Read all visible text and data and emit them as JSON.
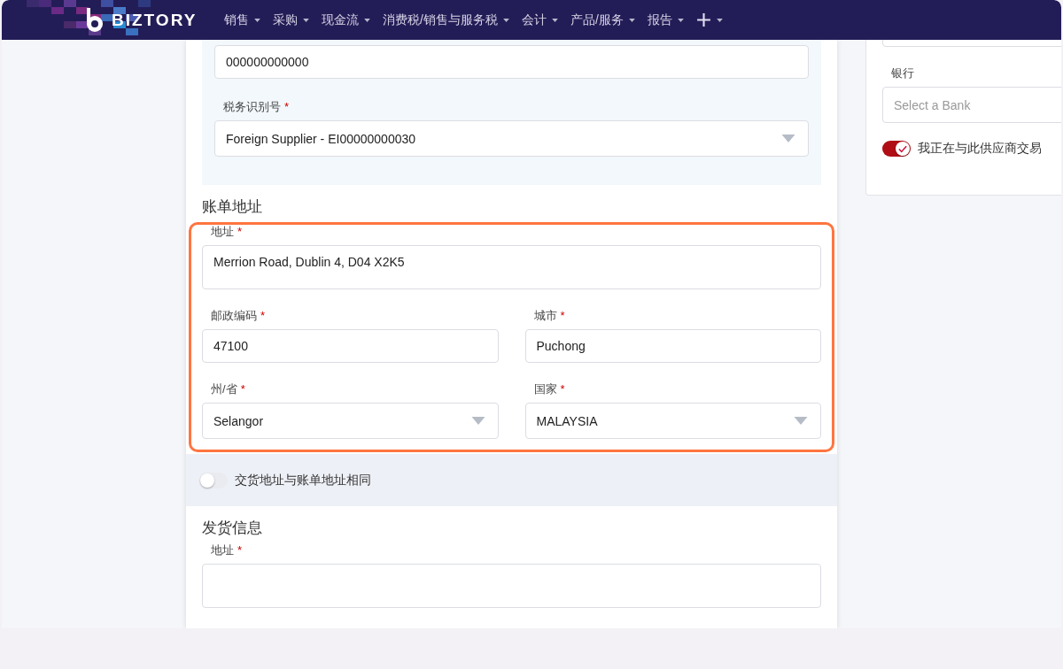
{
  "nav": {
    "brand": "BIZTORY",
    "menu": [
      {
        "kind": "menu",
        "label": "销售"
      },
      {
        "kind": "menu",
        "label": "采购"
      },
      {
        "kind": "menu",
        "label": "现金流"
      },
      {
        "kind": "menu",
        "label": "消费税/销售与服务税"
      },
      {
        "kind": "menu",
        "label": "会计"
      },
      {
        "kind": "menu",
        "label": "产品/服务"
      },
      {
        "kind": "menu",
        "label": "报告"
      },
      {
        "kind": "add"
      }
    ]
  },
  "tax_section": {
    "fields": [
      {
        "kind": "text",
        "value": "000000000000"
      },
      {
        "kind": "select",
        "label": "税务识别号",
        "asterisk": "*",
        "value": "Foreign Supplier - EI00000000030"
      }
    ]
  },
  "billing_address": {
    "title": "账单地址",
    "address": {
      "kind": "textarea",
      "label": "地址",
      "asterisk": "*",
      "value": "Merrion Road, Dublin 4, D04 X2K5"
    },
    "grid": [
      {
        "kind": "text",
        "label": "邮政编码",
        "asterisk": "*",
        "value": "47100"
      },
      {
        "kind": "text",
        "label": "城市",
        "asterisk": "*",
        "value": "Puchong"
      },
      {
        "kind": "select",
        "label": "州/省",
        "asterisk": "*",
        "value": "Selangor"
      },
      {
        "kind": "select",
        "label": "国家",
        "asterisk": "*",
        "value": "MALAYSIA"
      }
    ]
  },
  "same_address_toggle": {
    "label": "交货地址与账单地址相同",
    "on": false
  },
  "shipping_info": {
    "title": "发货信息",
    "address": {
      "kind": "textarea",
      "label": "地址",
      "asterisk": "*"
    }
  },
  "side_panel": {
    "fields": [
      {
        "kind": "text"
      },
      {
        "kind": "select",
        "label": "银行",
        "placeholder": "Select a Bank"
      }
    ],
    "toggle": {
      "label": "我正在与此供应商交易",
      "on": true
    }
  }
}
